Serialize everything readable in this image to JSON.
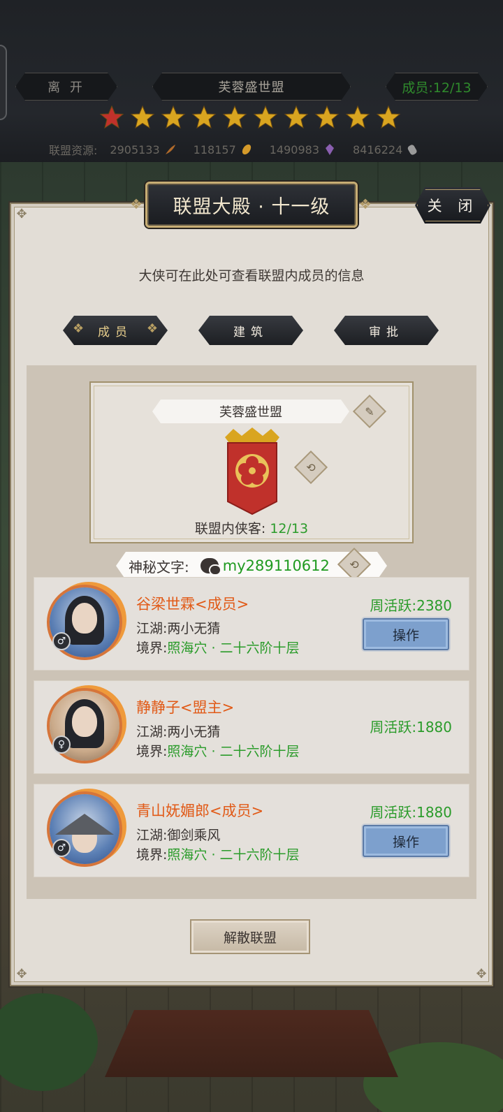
{
  "header": {
    "leave_label": "离 开",
    "alliance_title": "芙蓉盛世盟",
    "members_label": "成员:12/13",
    "stars": {
      "total": 10,
      "special_first": true
    },
    "resources_label": "联盟资源:",
    "resources": [
      {
        "value": "2905133",
        "icon": "feather-icon"
      },
      {
        "value": "118157",
        "icon": "leaf-coin-icon"
      },
      {
        "value": "1490983",
        "icon": "crystal-icon"
      },
      {
        "value": "8416224",
        "icon": "scroll-icon"
      }
    ]
  },
  "panel": {
    "title": "联盟大殿 · 十一级",
    "close_label": "关 闭",
    "description": "大侠可在此处可查看联盟内成员的信息",
    "tabs": [
      {
        "label": "成员",
        "active": true
      },
      {
        "label": "建筑",
        "active": false
      },
      {
        "label": "审批",
        "active": false
      }
    ]
  },
  "alliance_card": {
    "name": "芙蓉盛世盟",
    "member_count_label": "联盟内侠客:",
    "member_count": "12/13"
  },
  "secret": {
    "label": "神秘文字:",
    "value": "my289110612"
  },
  "members": [
    {
      "name": "谷梁世霖<成员>",
      "jianghu_label": "江湖:",
      "jianghu": "两小无猜",
      "realm_label": "境界:",
      "realm": "照海穴 · 二十六阶十层",
      "activity": "周活跃:2380",
      "gender": "♂",
      "action_label": "操作"
    },
    {
      "name": "静静子<盟主>",
      "jianghu_label": "江湖:",
      "jianghu": "两小无猜",
      "realm_label": "境界:",
      "realm": "照海穴 · 二十六阶十层",
      "activity": "周活跃:1880",
      "gender": "♀",
      "action_label": ""
    },
    {
      "name": "青山妩媚郎<成员>",
      "jianghu_label": "江湖:",
      "jianghu": "御剑乘风",
      "realm_label": "境界:",
      "realm": "照海穴 · 二十六阶十层",
      "activity": "周活跃:1880",
      "gender": "♂",
      "action_label": "操作"
    }
  ],
  "disband_label": "解散联盟",
  "colors": {
    "accent_green": "#2a9b2a",
    "name_orange": "#e15a17",
    "star_gold": "#d9a520",
    "star_red": "#c0312b"
  }
}
